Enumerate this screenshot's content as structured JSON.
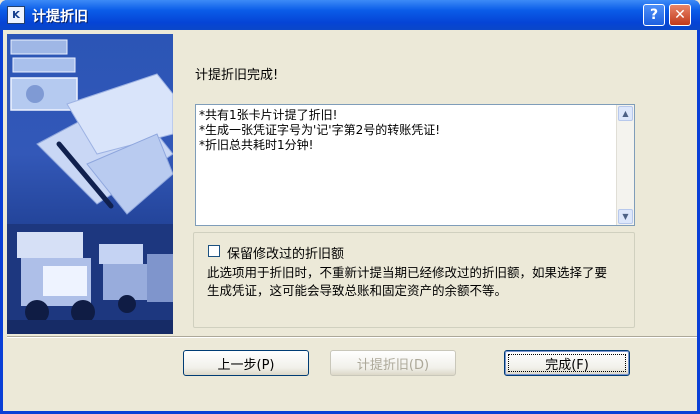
{
  "window": {
    "title": "计提折旧",
    "app_icon_letter": "K",
    "help_label": "?",
    "close_label": "✕"
  },
  "panel": {
    "status_label": "计提折旧完成!",
    "log_lines": [
      "*共有1张卡片计提了折旧!",
      "*生成一张凭证字号为'记'字第2号的转账凭证!",
      "*折旧总共耗时1分钟!"
    ],
    "scroll_up": "▲",
    "scroll_down": "▼"
  },
  "option": {
    "checkbox_label": "保留修改过的折旧额",
    "checked": false,
    "description": "此选项用于折旧时，不重新计提当期已经修改过的折旧额，如果选择了要生成凭证，这可能会导致总账和固定资产的余额不等。"
  },
  "buttons": {
    "prev_label": "上一步(P)",
    "depreciate_label": "计提折旧(D)",
    "finish_label": "完成(F)"
  },
  "icons": [
    "app-icon",
    "help-icon",
    "close-icon",
    "scroll-up-icon",
    "scroll-down-icon"
  ],
  "colors": {
    "titlebar": "#0a5ce8",
    "banner": "#2b55b6",
    "dialog_bg": "#ece9d8"
  }
}
